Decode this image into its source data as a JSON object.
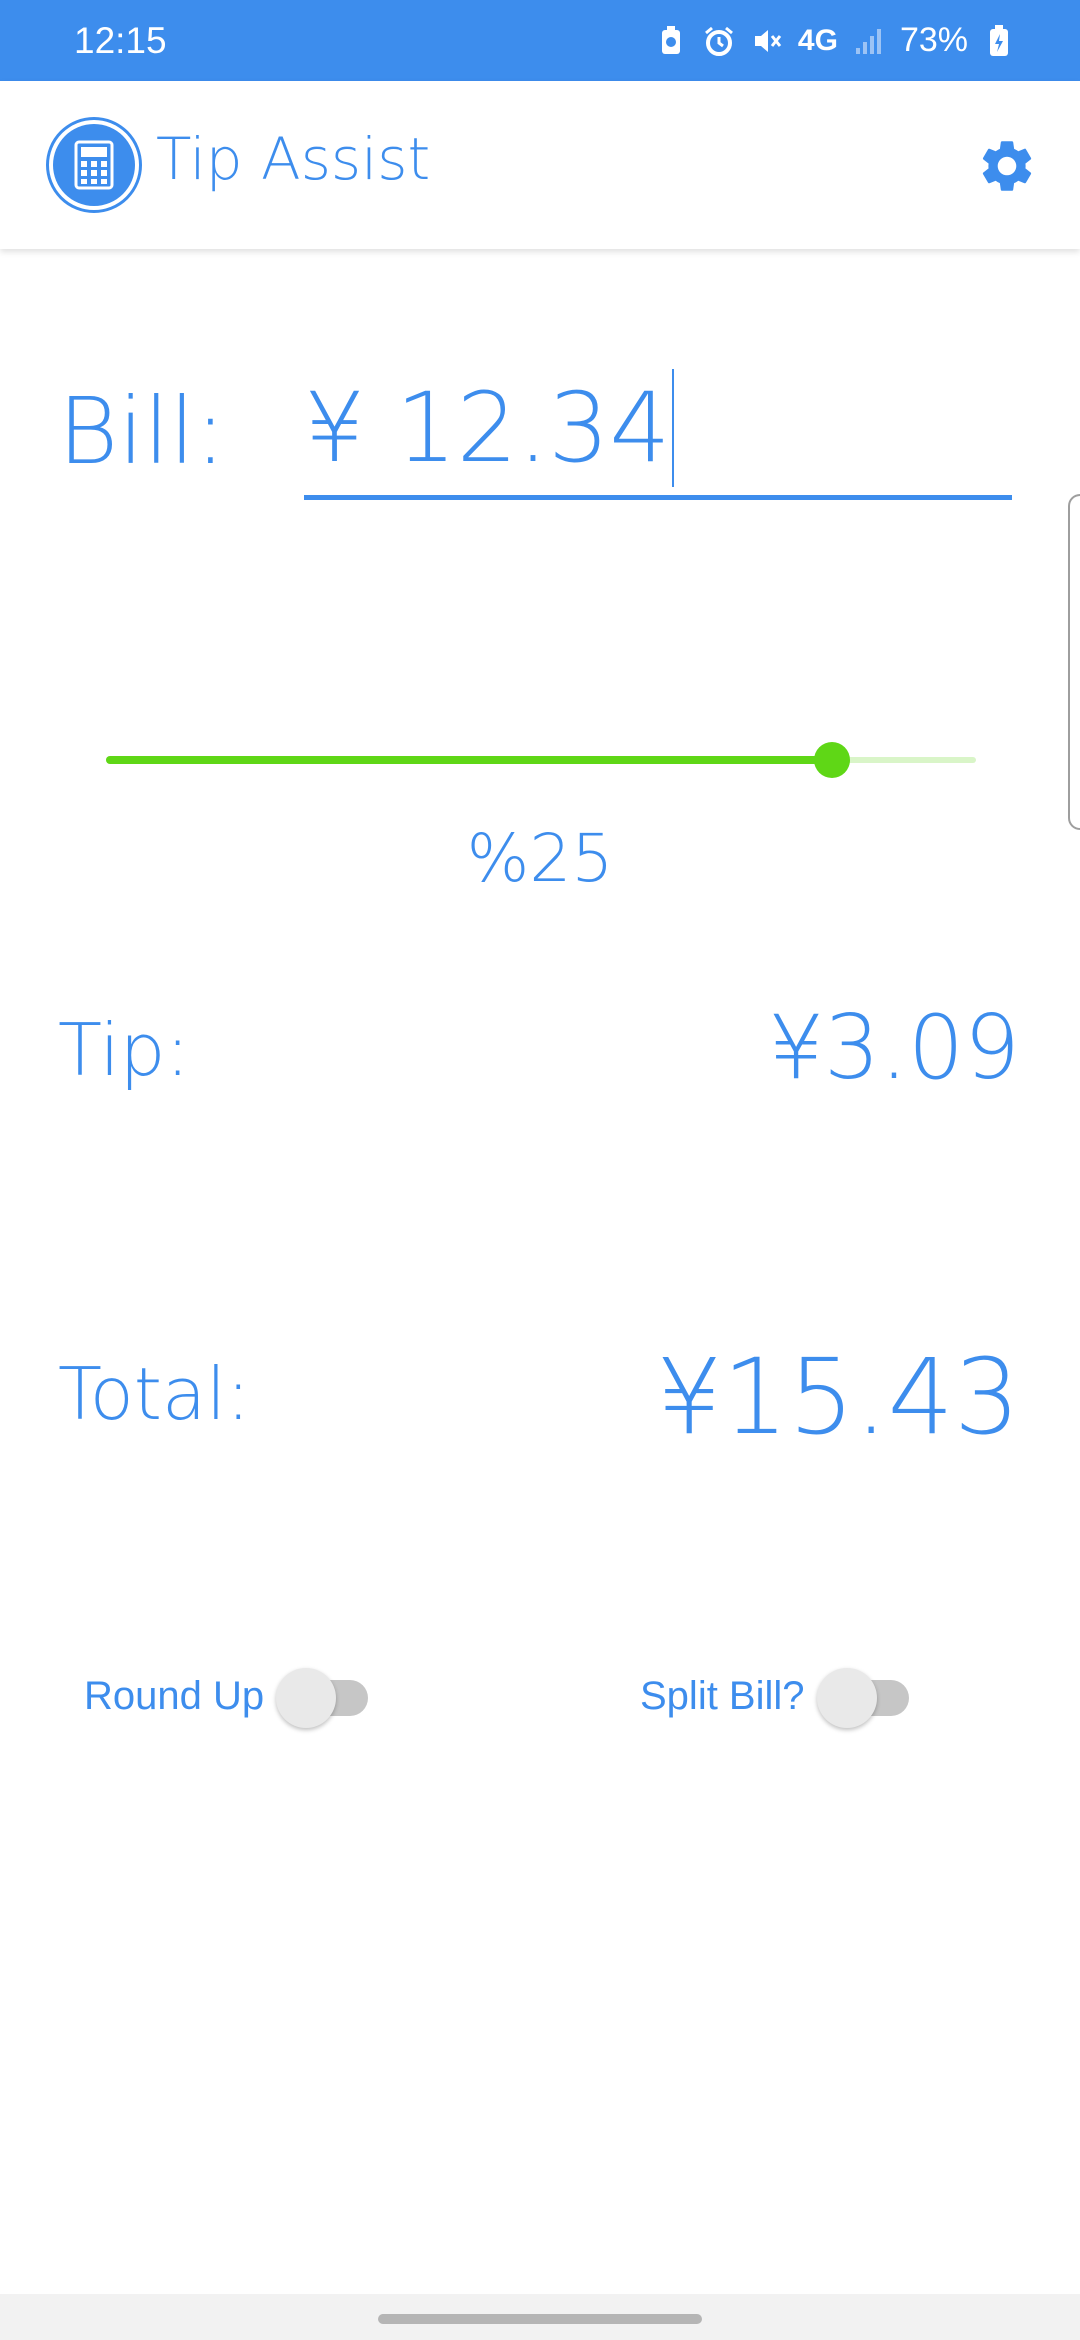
{
  "status_bar": {
    "time": "12:15",
    "network": "4G",
    "battery": "73%",
    "icons": [
      "battery-saver-icon",
      "alarm-icon",
      "mute-icon",
      "lte-icon",
      "signal-icon",
      "battery-charging-icon"
    ]
  },
  "app_bar": {
    "title": "Tip Assist",
    "logo_icon": "calculator-icon",
    "settings_icon": "gear-icon"
  },
  "bill": {
    "label": "Bill:",
    "value": "¥ 12.34"
  },
  "tip_slider": {
    "percent_label": "%25",
    "level": 0.835
  },
  "tip": {
    "label": "Tip:",
    "value": "¥3.09"
  },
  "total": {
    "label": "Total:",
    "value": "¥15.43"
  },
  "toggles": {
    "round_up": {
      "label": "Round Up",
      "on": false
    },
    "split_bill": {
      "label": "Split Bill?",
      "on": false
    }
  },
  "colors": {
    "primary": "#3d8ded",
    "slider_active": "#5fd716",
    "slider_inactive": "#d9f5c8"
  }
}
